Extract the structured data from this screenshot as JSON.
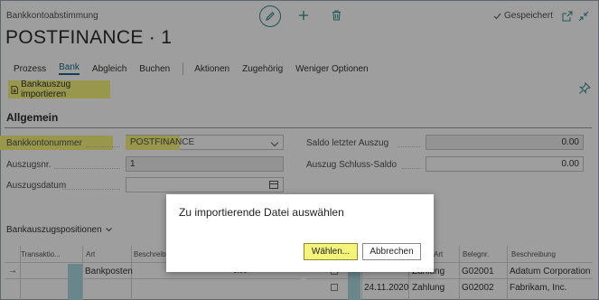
{
  "header": {
    "caption": "Bankkontoabstimmung",
    "title": "POSTFINANCE · 1",
    "saved_label": "Gespeichert",
    "icons": [
      "edit-icon",
      "plus-icon",
      "trash-icon",
      "check-icon",
      "open-new-window-icon",
      "collapse-icon"
    ]
  },
  "actionbar": {
    "items": [
      "Prozess",
      "Bank",
      "Abgleich",
      "Buchen",
      "Aktionen",
      "Zugehörig",
      "Weniger Optionen"
    ],
    "active": "Bank",
    "import_label": "Bankauszug importieren"
  },
  "section": {
    "title": "Allgemein",
    "bank_account_label": "Bankkontonummer",
    "bank_account_value": "POSTFINANCE",
    "statement_no_label": "Auszugsnr.",
    "statement_no_value": "1",
    "statement_date_label": "Auszugsdatum",
    "statement_date_value": "",
    "last_balance_label": "Saldo letzter Auszug",
    "last_balance_value": "0.00",
    "ending_balance_label": "Auszug Schluss-Saldo",
    "ending_balance_value": "0.00"
  },
  "lines": {
    "title": "Bankauszugspositionen",
    "left_headers": [
      "Transaktio...",
      "Art",
      "Beschreibu..."
    ],
    "right_headers": [
      "Art",
      "Belegnr.",
      "Beschreibung"
    ],
    "left_rows": [
      {
        "indicator": "→",
        "art": "Bankposten",
        "desc": "",
        "amount": "0.00"
      }
    ],
    "right_rows": [
      {
        "date": "",
        "art": "Zahlung",
        "doc": "G02001",
        "desc": "Adatum Corporation"
      },
      {
        "date": "24.11.2020",
        "art": "Zahlung",
        "doc": "G02002",
        "desc": "Fabrikam, Inc."
      }
    ]
  },
  "dialog": {
    "title": "Zu importierende Datei auswählen",
    "choose_label": "Wählen...",
    "cancel_label": "Abbrechen"
  },
  "colors": {
    "highlight": "#f5f47a",
    "accent": "#1a6b86",
    "edit_ring": "#2f8a8a"
  }
}
